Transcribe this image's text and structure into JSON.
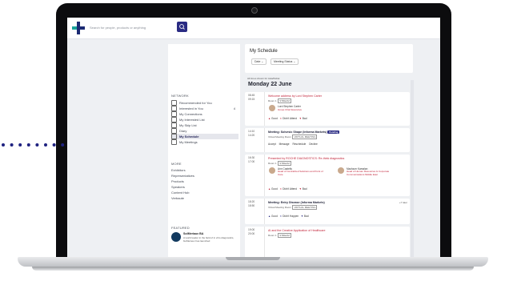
{
  "search": {
    "placeholder": "Search for people, products or anything"
  },
  "sidebar": {
    "network_title": "NETWORK",
    "network_items": [
      {
        "label": "Recommended for You"
      },
      {
        "label": "Interested in You",
        "count": "4"
      },
      {
        "label": "My Connections"
      },
      {
        "label": "My Interested List"
      },
      {
        "label": "My Skip List"
      },
      {
        "label": "Diary"
      },
      {
        "label": "My Schedule"
      },
      {
        "label": "My Meetings"
      }
    ],
    "more_title": "MORE",
    "more_items": [
      "Exhibitors",
      "Representatives",
      "Products",
      "Speakers",
      "Content Hub",
      "Verbaute"
    ],
    "featured_title": "FEATURED",
    "featured": {
      "name": "SolMeriaux BA",
      "text": "A world leader in the field of in vitro diagnostics, bioMerieux has launched"
    }
  },
  "schedule": {
    "title": "My Schedule",
    "filters": [
      "Date",
      "Meeting Status"
    ],
    "tz_note": "All times shown for Asia/Dubai",
    "day": "Monday 22 June",
    "events": [
      {
        "start": "08:45",
        "end": "09:15",
        "title": "Welcome address by Lord Stephen Carter",
        "room": "Room 1",
        "stream": "STREAM",
        "person": "Lord Stephen Carter",
        "role": "Group Chief Executive",
        "actions": [
          "Good",
          "Didn't Attend",
          "Bad"
        ]
      },
      {
        "start": "14:10",
        "end": "14:20",
        "title": "Meeting: Solvesic Shape (Informa Markets)",
        "status": "Pending",
        "room": "Virtual Meeting Room",
        "stream": "VIRTUAL MEETING",
        "actions": [
          "Accept",
          "Message",
          "Reschedule",
          "Decline"
        ]
      },
      {
        "start": "16:30",
        "end": "17:00",
        "title": "Presented by ROCHE DIAGNOSTICS: Re-think diagnostics",
        "room": "Room 1",
        "stream": "STREAM",
        "speakers": [
          {
            "name": "Ann Castells",
            "role": "Head of Centralized Solutions and Point of Care"
          },
          {
            "name": "Mazloum Kamalan",
            "role": "Head of Human Resources & Corporate Communications Middle East"
          }
        ],
        "actions": [
          "Good",
          "Didn't Attend",
          "Bad"
        ]
      },
      {
        "start": "18:20",
        "end": "18:50",
        "title": "Meeting: Entry Disease (Informa Markets)",
        "room": "Virtual Meeting Room",
        "stream": "VIRTUAL MEETING",
        "side": "+7 later",
        "actions": [
          "Good",
          "Didn't Happen",
          "Bad"
        ]
      },
      {
        "start": "19:00",
        "end": "20:00",
        "title": "AI and the Creative Application of Healthcare",
        "room": "Room 1",
        "stream": "STREAM"
      }
    ]
  },
  "colors": {
    "brand": "#2a2b83",
    "accent": "#c2243a",
    "logo_blue": "#1b2a73",
    "logo_teal": "#1aa39a"
  }
}
